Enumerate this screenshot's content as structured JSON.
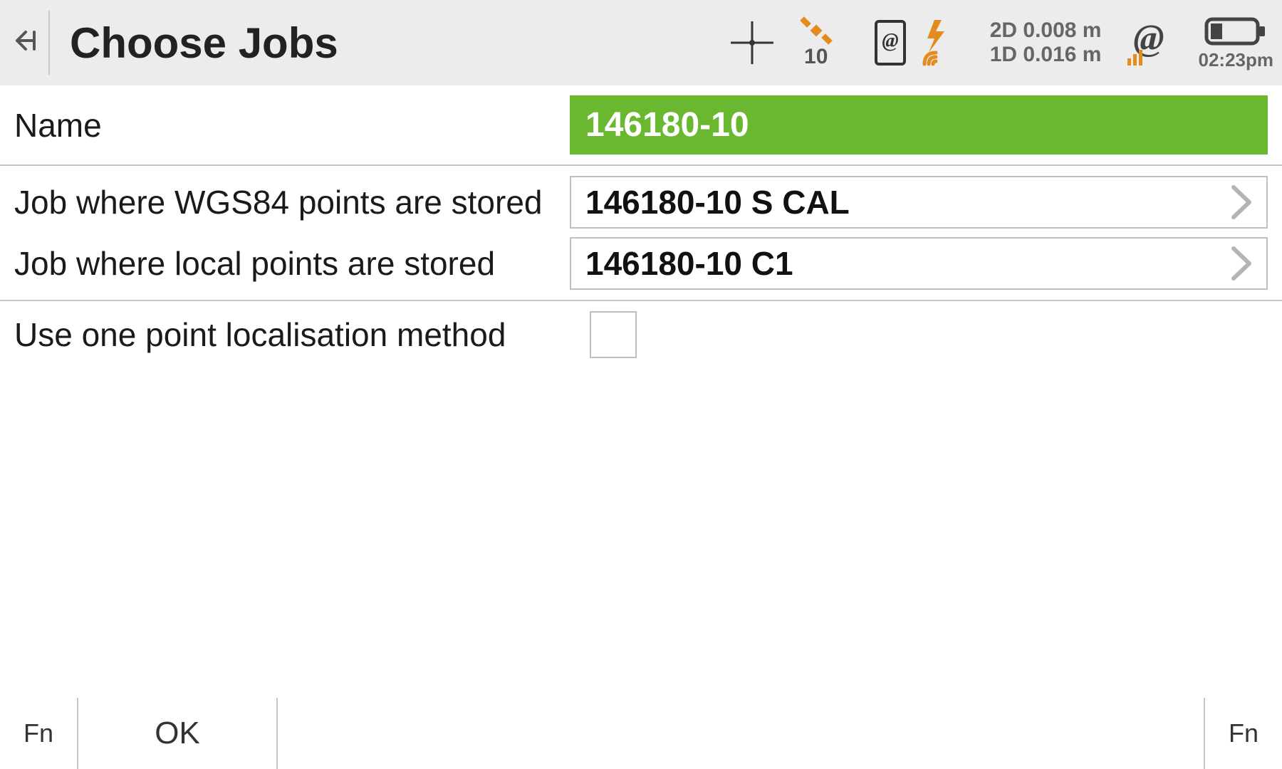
{
  "header": {
    "title": "Choose Jobs",
    "sat_count": "10",
    "precision_2d": "2D 0.008 m",
    "precision_1d": "1D 0.016 m",
    "time": "02:23pm"
  },
  "form": {
    "name_label": "Name",
    "name_value": "146180-10",
    "wgs_label": "Job where WGS84 points are stored",
    "wgs_value": "146180-10 S CAL",
    "local_label": "Job where local points are stored",
    "local_value": "146180-10 C1",
    "onepoint_label": "Use one point localisation method",
    "onepoint_checked": false
  },
  "footer": {
    "fn_left": "Fn",
    "ok": "OK",
    "fn_right": "Fn"
  }
}
